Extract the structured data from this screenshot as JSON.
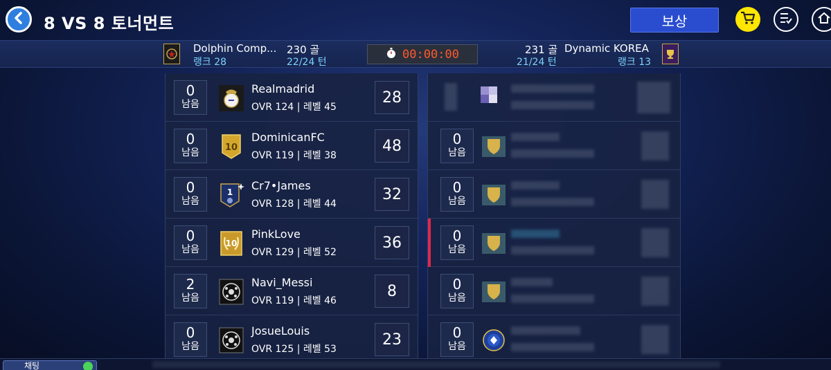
{
  "header": {
    "title": "8 VS 8 토너먼트",
    "reward_label": "보상",
    "icons": [
      "back-arrow-icon",
      "cart-icon",
      "checklist-icon",
      "home-icon"
    ]
  },
  "scoreboard": {
    "left": {
      "name": "Dolphin Comp...",
      "rank": "랭크 28",
      "goals": "230 골",
      "turns": "22/24 턴"
    },
    "right": {
      "name": "Dynamic KOREA",
      "rank": "랭크 13",
      "goals": "231 골",
      "turns": "21/24 턴"
    },
    "timer": "00:00:00",
    "timer_color": "#ff5a2a"
  },
  "left_players": [
    {
      "remain": "0",
      "remain_label": "남음",
      "name": "Realmadrid",
      "info": "OVR 124 | 레벨 45",
      "score": "28",
      "emblem": "real-madrid-crest-icon"
    },
    {
      "remain": "0",
      "remain_label": "남음",
      "name": "DominicanFC",
      "info": "OVR 119 | 레벨 38",
      "score": "48",
      "emblem": "gold-10-badge-icon"
    },
    {
      "remain": "0",
      "remain_label": "남음",
      "name": "Cr7•James",
      "info": "OVR 128 | 레벨 44",
      "score": "32",
      "emblem": "star-1-badge-icon"
    },
    {
      "remain": "0",
      "remain_label": "남음",
      "name": "PinkLove",
      "info": "OVR 129 | 레벨 52",
      "score": "36",
      "emblem": "laurel-10-badge-icon"
    },
    {
      "remain": "2",
      "remain_label": "남음",
      "name": "Navi_Messi",
      "info": "OVR 119 | 레벨 46",
      "score": "8",
      "emblem": "soccer-ball-badge-icon"
    },
    {
      "remain": "0",
      "remain_label": "남음",
      "name": "JosueLouis",
      "info": "OVR 125 | 레벨 53",
      "score": "23",
      "emblem": "soccer-ball-badge-icon"
    }
  ],
  "right_players": [
    {
      "remain": "",
      "remain_label": "",
      "emblem": "blurred-emblem"
    },
    {
      "remain": "0",
      "remain_label": "남음",
      "emblem": "gold-shield-icon"
    },
    {
      "remain": "0",
      "remain_label": "남음",
      "emblem": "gold-shield-icon"
    },
    {
      "remain": "0",
      "remain_label": "남음",
      "emblem": "gold-shield-icon"
    },
    {
      "remain": "0",
      "remain_label": "남음",
      "emblem": "gold-shield-icon"
    },
    {
      "remain": "0",
      "remain_label": "남음",
      "emblem": "chelsea-crest-icon"
    }
  ],
  "chat": {
    "tab_label": "채팅"
  }
}
